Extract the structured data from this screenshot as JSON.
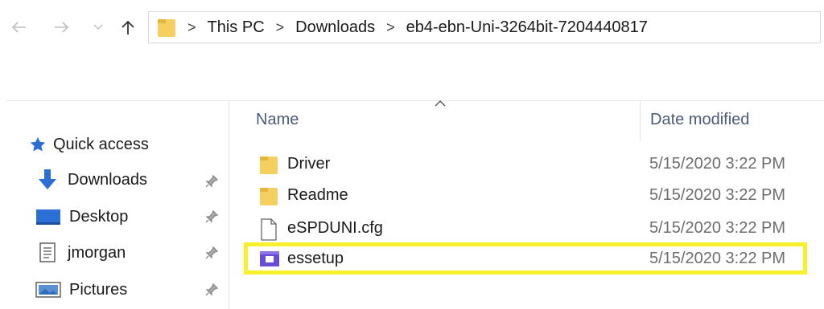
{
  "nav": {
    "back_icon": "arrow-left-icon",
    "forward_icon": "arrow-right-icon",
    "recent_icon": "chevron-down-icon",
    "up_icon": "arrow-up-icon"
  },
  "address": {
    "segments": [
      "This PC",
      "Downloads",
      "eb4-ebn-Uni-3264bit-7204440817"
    ]
  },
  "columns": {
    "name": "Name",
    "date_modified": "Date modified"
  },
  "sidebar": {
    "items": [
      {
        "label": "Quick access",
        "icon": "star-icon",
        "pinned": false
      },
      {
        "label": "Downloads",
        "icon": "download-arrow-icon",
        "pinned": true
      },
      {
        "label": "Desktop",
        "icon": "desktop-icon",
        "pinned": true
      },
      {
        "label": "jmorgan",
        "icon": "document-icon",
        "pinned": true
      },
      {
        "label": "Pictures",
        "icon": "pictures-icon",
        "pinned": true
      }
    ]
  },
  "files": [
    {
      "name": "Driver",
      "date": "5/15/2020 3:22 PM",
      "type": "folder"
    },
    {
      "name": "Readme",
      "date": "5/15/2020 3:22 PM",
      "type": "folder"
    },
    {
      "name": "eSPDUNI.cfg",
      "date": "5/15/2020 3:22 PM",
      "type": "file"
    },
    {
      "name": "essetup",
      "date": "5/15/2020 3:22 PM",
      "type": "setup-exe",
      "highlighted": true
    }
  ],
  "colors": {
    "highlight": "#f8f12a",
    "folder": "#f6cf61",
    "accent_blue": "#2b6fd6",
    "setup_purple": "#6a4bd6"
  }
}
